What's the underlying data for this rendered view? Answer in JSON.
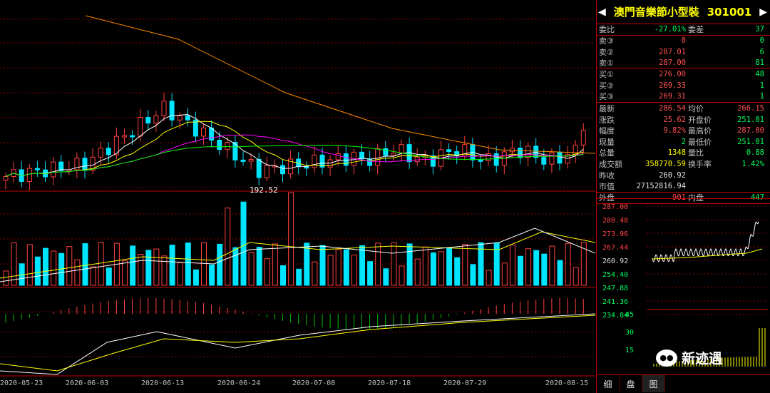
{
  "stock": {
    "name": "澳門音樂節小型裝",
    "code": "301001",
    "prev_arrow": "◀",
    "next_arrow": "▶"
  },
  "order": {
    "weibi_label": "委比",
    "weibi": "-27.01%",
    "weicha_label": "委差",
    "weicha": "37",
    "sells": [
      {
        "label": "卖③",
        "price": "0",
        "vol": "0"
      },
      {
        "label": "卖②",
        "price": "287.01",
        "vol": "6"
      },
      {
        "label": "卖①",
        "price": "287.00",
        "vol": "81"
      }
    ],
    "buys": [
      {
        "label": "买①",
        "price": "276.00",
        "vol": "48"
      },
      {
        "label": "买②",
        "price": "269.33",
        "vol": "1"
      },
      {
        "label": "买③",
        "price": "269.31",
        "vol": "1"
      }
    ]
  },
  "quote": [
    {
      "l1": "最新",
      "v1": "286.54",
      "l2": "均价",
      "v2": "266.15"
    },
    {
      "l1": "涨跌",
      "v1": "25.62",
      "l2": "开盘价",
      "v2": "251.01"
    },
    {
      "l1": "幅度",
      "v1": "9.82%",
      "l2": "最高价",
      "v2": "287.00"
    },
    {
      "l1": "现量",
      "v1": "2",
      "l2": "最低价",
      "v2": "251.01"
    },
    {
      "l1": "总量",
      "v1": "1348",
      "l2": "量比",
      "v2": "0.88"
    },
    {
      "l1": "成交额",
      "v1": "358770.59",
      "l2": "换手率",
      "v2": "1.42%"
    },
    {
      "l1": "昨收",
      "v1": "260.92",
      "l2": "",
      "v2": ""
    },
    {
      "l1": "市值",
      "v1": "27152816.94",
      "l2": "",
      "v2": ""
    }
  ],
  "outer": {
    "label": "外盘",
    "value": "901",
    "inner_label": "内盘",
    "inner_value": "447"
  },
  "mini_axis": [
    "287.00",
    "280.48",
    "273.96",
    "267.44",
    "260.92",
    "254.40",
    "247.88",
    "241.36",
    "234.84"
  ],
  "mini_vol_axis": [
    "45",
    "30",
    "15"
  ],
  "low_marker": "192.52",
  "dates": [
    "2020-05-23",
    "2020-06-03",
    "2020-06-13",
    "2020-06-24",
    "2020-07-08",
    "2020-07-18",
    "2020-07-29",
    "2020-08-15"
  ],
  "tabs": [
    "细",
    "盘",
    "图"
  ],
  "watermark": "新迹遇",
  "colors": {
    "up": "#ff4040",
    "down": "#00e5ff",
    "grid": "#8b0000",
    "text": "#c0c0c0",
    "accent": "#ffff00"
  }
}
